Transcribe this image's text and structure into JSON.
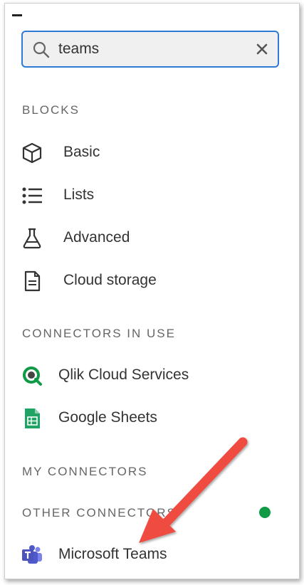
{
  "search": {
    "value": "teams",
    "clear_symbol": "×"
  },
  "sections": {
    "blocks": "BLOCKS",
    "connectors_in_use": "CONNECTORS IN USE",
    "my_connectors": "MY CONNECTORS",
    "other_connectors": "OTHER CONNECTORS"
  },
  "blocks": [
    {
      "label": "Basic",
      "icon": "cube-icon"
    },
    {
      "label": "Lists",
      "icon": "list-icon"
    },
    {
      "label": "Advanced",
      "icon": "flask-icon"
    },
    {
      "label": "Cloud storage",
      "icon": "document-icon"
    }
  ],
  "connectors_in_use": [
    {
      "label": "Qlik Cloud Services",
      "icon": "qlik-icon"
    },
    {
      "label": "Google Sheets",
      "icon": "google-sheets-icon"
    }
  ],
  "other_connectors": [
    {
      "label": "Microsoft Teams",
      "icon": "microsoft-teams-icon"
    }
  ],
  "colors": {
    "search_border": "#2f7ad6",
    "status_dot": "#109a46",
    "annotation_arrow": "#ef4b3f",
    "qlik_green": "#109a46",
    "sheets_green": "#1fa463",
    "teams_purple": "#5059c9"
  }
}
